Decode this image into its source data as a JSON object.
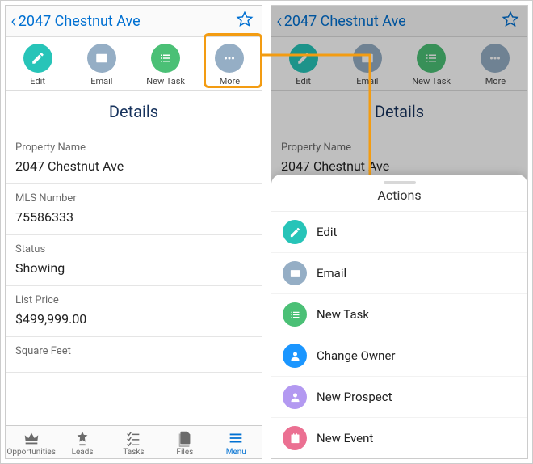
{
  "header": {
    "title": "2047 Chestnut Ave"
  },
  "actions_row": {
    "items": [
      {
        "label": "Edit"
      },
      {
        "label": "Email"
      },
      {
        "label": "New Task"
      },
      {
        "label": "More"
      }
    ]
  },
  "section_title": "Details",
  "fields": [
    {
      "label": "Property Name",
      "value": "2047 Chestnut Ave"
    },
    {
      "label": "MLS Number",
      "value": "75586333"
    },
    {
      "label": "Status",
      "value": "Showing"
    },
    {
      "label": "List Price",
      "value": "$499,999.00"
    },
    {
      "label": "Square Feet",
      "value": ""
    }
  ],
  "tabbar": {
    "items": [
      {
        "label": "Opportunities"
      },
      {
        "label": "Leads"
      },
      {
        "label": "Tasks"
      },
      {
        "label": "Files"
      },
      {
        "label": "Menu"
      }
    ]
  },
  "sheet": {
    "title": "Actions",
    "items": [
      {
        "label": "Edit"
      },
      {
        "label": "Email"
      },
      {
        "label": "New Task"
      },
      {
        "label": "Change Owner"
      },
      {
        "label": "New Prospect"
      },
      {
        "label": "New Event"
      }
    ]
  }
}
